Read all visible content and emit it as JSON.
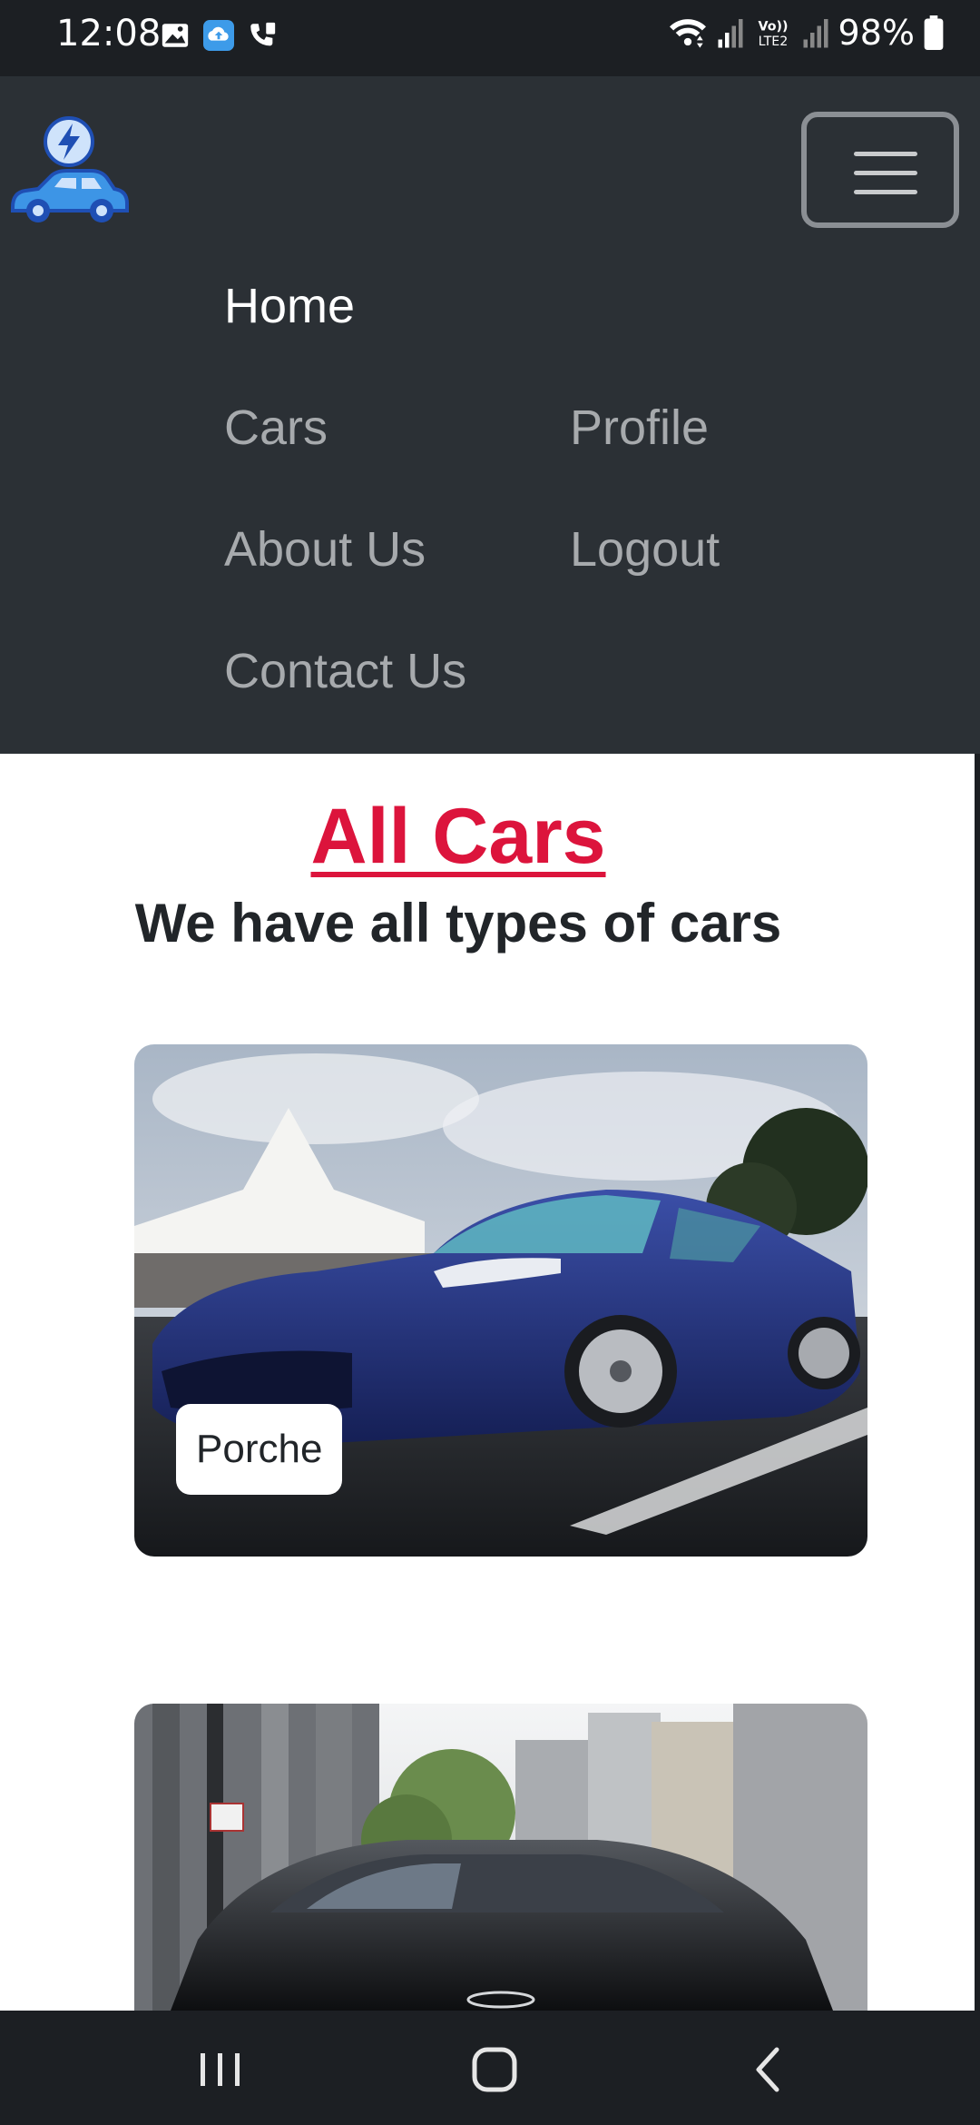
{
  "status_bar": {
    "time": "12:08",
    "battery": "98%",
    "left_icons": [
      "gallery-icon",
      "cloud-upload-icon",
      "call-icon"
    ],
    "right_icons": [
      "wifi-icon",
      "signal-icon",
      "volte-icon",
      "signal-icon",
      "battery-icon"
    ]
  },
  "navbar": {
    "logo": "electric-car-logo",
    "toggler_icon": "hamburger-icon",
    "links": {
      "home": "Home",
      "cars": "Cars",
      "profile": "Profile",
      "about": "About Us",
      "logout": "Logout",
      "contact": "Contact Us"
    },
    "active": "Home"
  },
  "main": {
    "title": "All Cars",
    "subtitle": "We have all types of cars",
    "cards": [
      {
        "label": "Porche",
        "image": "blue-sports-car-photo"
      },
      {
        "image": "black-car-street-photo"
      }
    ]
  },
  "system_nav": {
    "buttons": [
      "recent-apps-icon",
      "home-icon",
      "back-icon"
    ]
  },
  "colors": {
    "navbar_bg": "#2b3035",
    "title_accent": "#dc143c",
    "status_bar_bg": "#1c1f23"
  }
}
